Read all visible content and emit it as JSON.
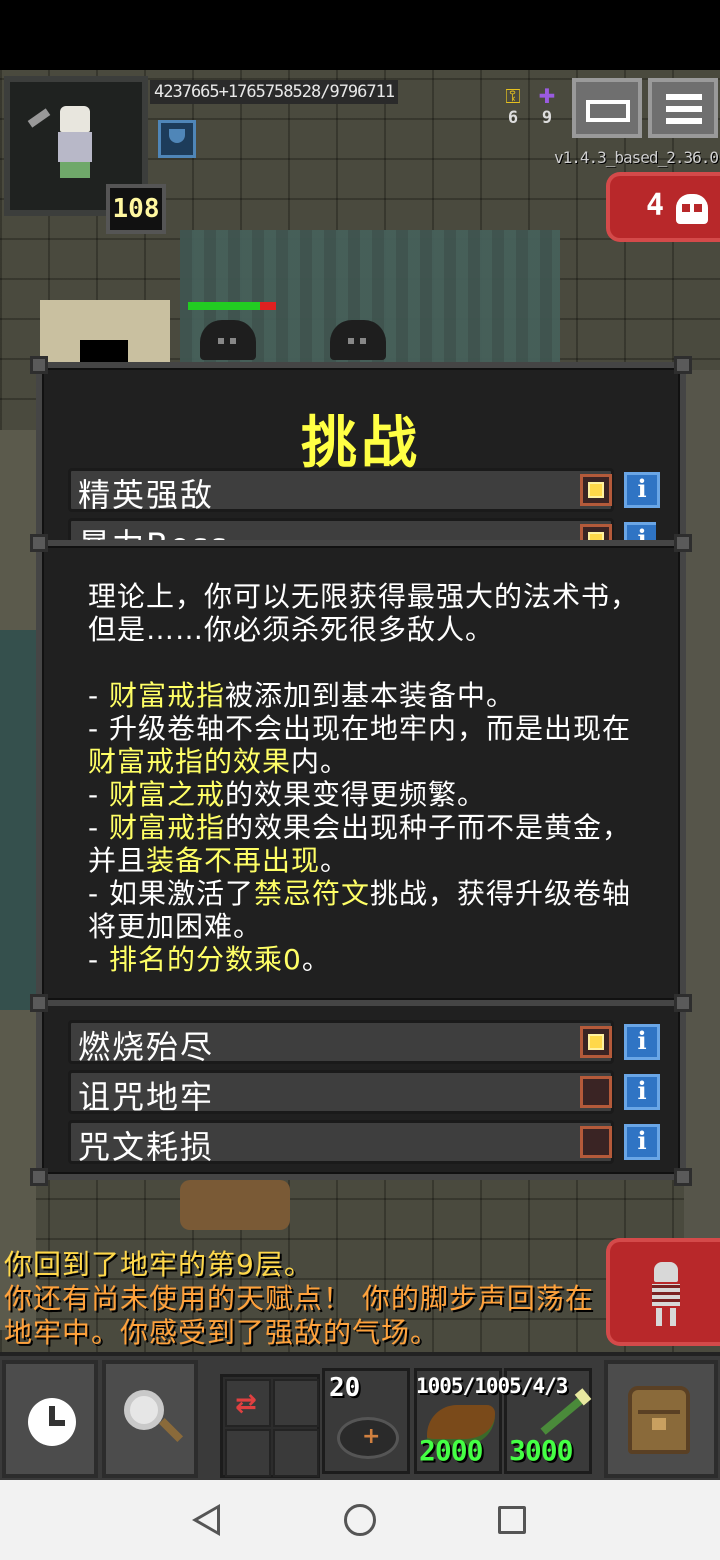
{
  "hud": {
    "xp_text": "4237665+1765758528/9796711",
    "hero_level": "108",
    "gold_count": "6",
    "energy_count": "9",
    "version": "v1.4.3_based_2.36.0",
    "danger_count": "4"
  },
  "challenge_window": {
    "title": "挑战",
    "top_rows": [
      {
        "label": "精英强敌",
        "checked": true
      },
      {
        "label": "暴力Boss",
        "checked": true
      }
    ],
    "bottom_rows": [
      {
        "label": "燃烧殆尽",
        "checked": true
      },
      {
        "label": "诅咒地牢",
        "checked": false
      },
      {
        "label": "咒文耗损",
        "checked": false
      }
    ],
    "info_glyph": "i"
  },
  "description": {
    "intro": "理论上，你可以无限获得最强大的法术书，但是……你必须杀死很多敌人。",
    "b1_hl": "财富戒指",
    "b1_rest": "被添加到基本装备中。",
    "b2_text": "升级卷轴不会出现在地牢内，而是出现在",
    "b2_hl": "财富戒指的效果",
    "b2_end": "内。",
    "b3_hl": "财富之戒",
    "b3_rest": "的效果变得更频繁。",
    "b4_hl": "财富戒指",
    "b4_rest": "的效果会出现种子而不是黄金，并且",
    "b4_hl2": "装备不再出现",
    "b4_end": "。",
    "b5_pre": "如果激活了",
    "b5_hl": "禁忌符文",
    "b5_rest": "挑战，获得升级卷轴将更加困难。",
    "b6_hl": "排名的分数乘0",
    "b6_end": "。",
    "dash": "- "
  },
  "log": {
    "line1": "你回到了地牢的第9层。",
    "line2": "你还有尚未使用的天赋点！ 你的脚步声回荡在地牢中。你感受到了强敌的气场。"
  },
  "toolbar": {
    "stone_count": "20",
    "ammo_text": "1005/1005/4/3",
    "slot2_qty": "2000",
    "slot3_qty": "3000"
  },
  "colors": {
    "title_yellow": "#ffff44",
    "highlight_yellow": "#ffff66",
    "danger_red": "#b8282a",
    "info_blue": "#2f74c4",
    "qty_green": "#44ff44"
  }
}
